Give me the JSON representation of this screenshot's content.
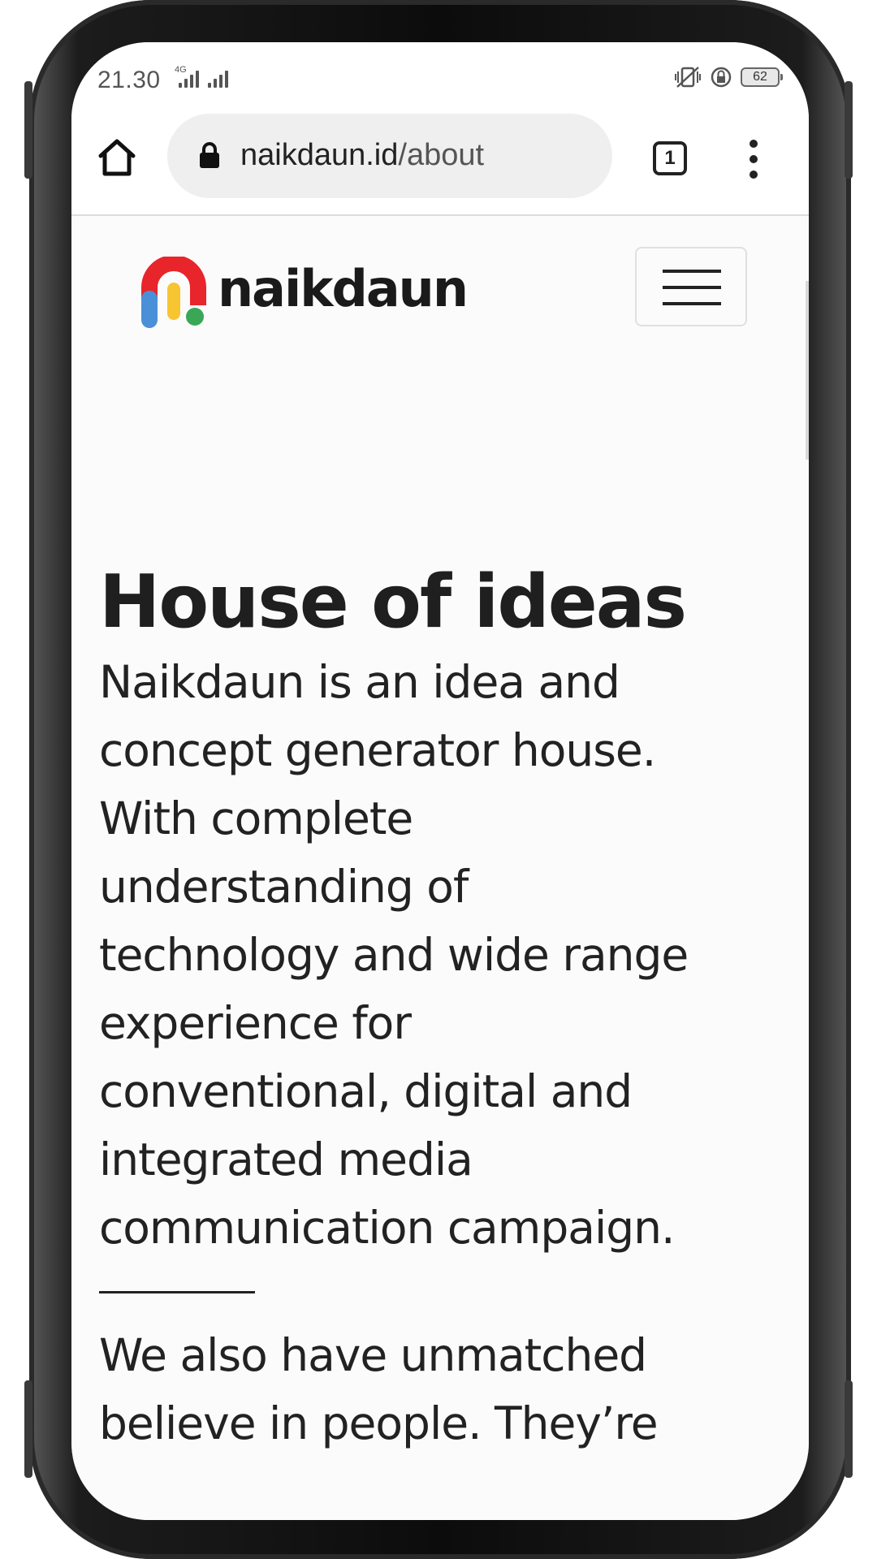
{
  "status_bar": {
    "time": "21.30",
    "network": "4G",
    "battery": "62"
  },
  "browser": {
    "url_domain": "naikdaun.id",
    "url_path": "/about",
    "tab_count": "1"
  },
  "site": {
    "logo_text": "naikdaun",
    "logo_colors": {
      "arch": "#e8252b",
      "left_leg": "#4a90d9",
      "middle": "#f7c531",
      "right_leg": "#3aa757"
    }
  },
  "hero": {
    "headline": "House of ideas",
    "paragraph_lines": [
      "Naikdaun is an idea and",
      "concept generator house.",
      "With complete",
      "understanding of",
      "technology and wide range",
      "experience for",
      "conventional, digital and",
      "integrated media",
      "communication campaign."
    ],
    "second_paragraph_lines": [
      "We also have unmatched",
      "believe in people. They’re"
    ]
  }
}
